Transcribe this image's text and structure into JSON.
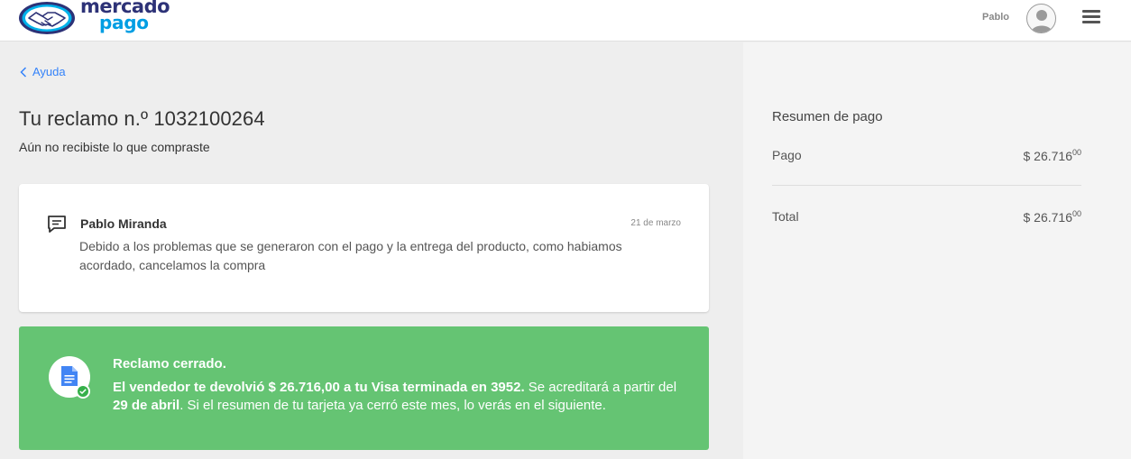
{
  "header": {
    "logo_line1": "mercado",
    "logo_line2": "pago",
    "user_name": "Pablo",
    "icons": {
      "avatar": "user-avatar-icon",
      "menu": "hamburger-menu-icon"
    }
  },
  "nav": {
    "back_label": "Ayuda",
    "back_icon": "chevron-left-icon"
  },
  "claim": {
    "title": "Tu reclamo n.º 1032100264",
    "subtitle": "Aún no recibiste lo que compraste"
  },
  "message": {
    "icon": "chat-bubble-icon",
    "author": "Pablo Miranda",
    "date": "21 de marzo",
    "body": "Debido a los problemas que se generaron con el pago y la entrega del producto, como habiamos acordado, cancelamos la compra"
  },
  "status": {
    "icon": "document-check-icon",
    "title": "Reclamo cerrado.",
    "body_bold1": "El vendedor te devolvió $ 26.716,00 a tu Visa terminada en 3952.",
    "body_text1": " Se acreditará a partir del ",
    "body_bold2": "29 de abril",
    "body_text2": ". Si el resumen de tu tarjeta ya cerró este mes, lo verás en el siguiente.",
    "background_color": "#65c473"
  },
  "summary": {
    "title": "Resumen de pago",
    "rows": [
      {
        "label": "Pago",
        "amount": "$ 26.716",
        "cents": "00"
      },
      {
        "label": "Total",
        "amount": "$ 26.716",
        "cents": "00"
      }
    ]
  },
  "colors": {
    "link": "#3483fa",
    "brand_dark": "#2d3277",
    "brand_light": "#009ee3",
    "success": "#65c473"
  }
}
